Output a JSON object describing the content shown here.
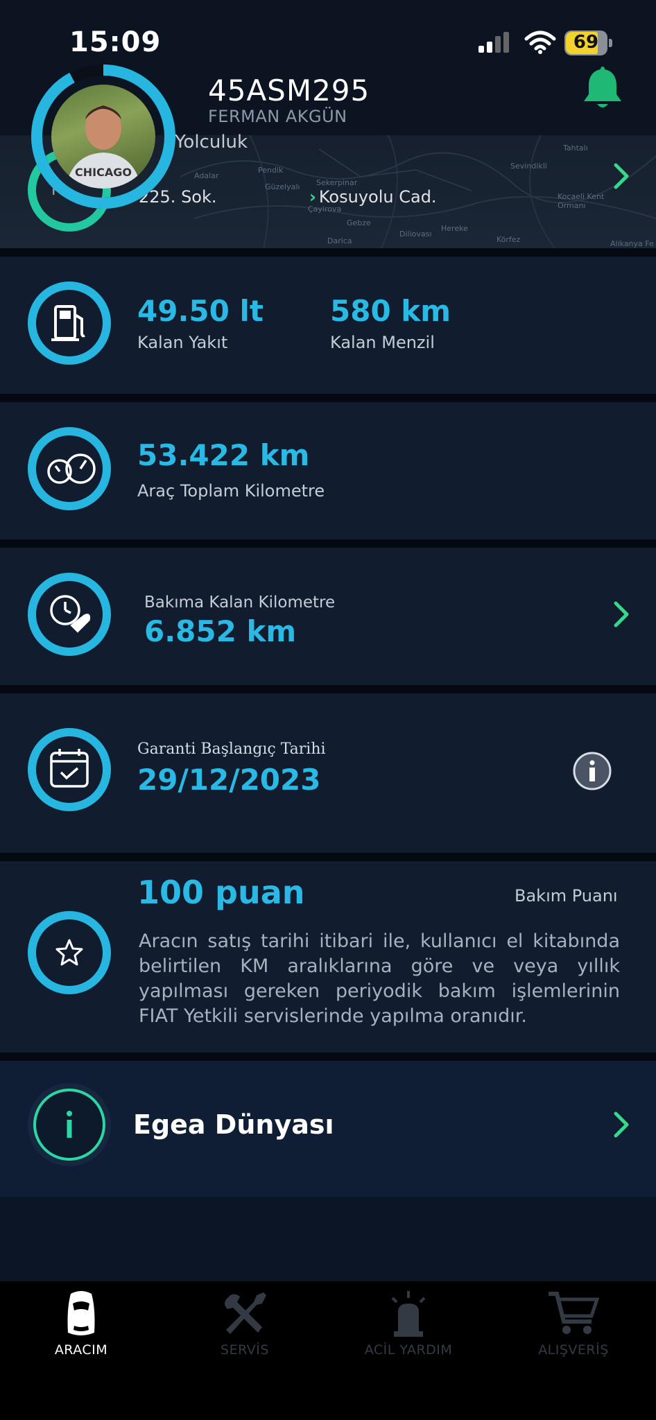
{
  "status_bar": {
    "time": "15:09",
    "battery": "69"
  },
  "header": {
    "plate": "45ASM295",
    "owner": "FERMAN AKGÜN"
  },
  "trip": {
    "title": "Yolculuk",
    "from": "225. Sok.",
    "to": "Kosuyolu Cad.",
    "ring_letter": "P",
    "map_labels": [
      "Adalar",
      "Pendik",
      "Güzelyalı",
      "Sekerpinar",
      "Çayirova",
      "Gebze",
      "Darica",
      "Diliovası",
      "Hereke",
      "Körfez",
      "Tahtalı",
      "Sevindikli",
      "Kocaeli Kent Ormanı",
      "Alikanya Fe"
    ]
  },
  "fuel": {
    "fuel_value": "49.50 lt",
    "fuel_label": "Kalan Yakıt",
    "range_value": "580 km",
    "range_label": "Kalan Menzil"
  },
  "odometer": {
    "value": "53.422 km",
    "label": "Araç Toplam Kilometre"
  },
  "maintenance": {
    "label": "Bakıma Kalan Kilometre",
    "value": "6.852 km"
  },
  "warranty": {
    "label": "Garanti Başlangıç Tarihi",
    "value": "29/12/2023"
  },
  "score": {
    "value": "100 puan",
    "label": "Bakım Puanı",
    "description": "Aracın satış tarihi itibari ile, kullanıcı el kitabında belirtilen KM aralıklarına göre ve veya yıllık yapılması gereken periyodik bakım işlemlerinin FIAT Yetkili servislerinde yapılma oranıdır."
  },
  "egea": {
    "label": "Egea Dünyası"
  },
  "tabs": [
    {
      "label": "ARACIM",
      "icon": "car-icon"
    },
    {
      "label": "SERVİS",
      "icon": "tools-icon"
    },
    {
      "label": "ACİL YARDIM",
      "icon": "siren-icon"
    },
    {
      "label": "ALIŞVERİŞ",
      "icon": "cart-icon"
    }
  ],
  "colors": {
    "accent": "#2ab9e4",
    "green": "#34d98a",
    "background": "#0b1526",
    "card": "#111c2e"
  }
}
